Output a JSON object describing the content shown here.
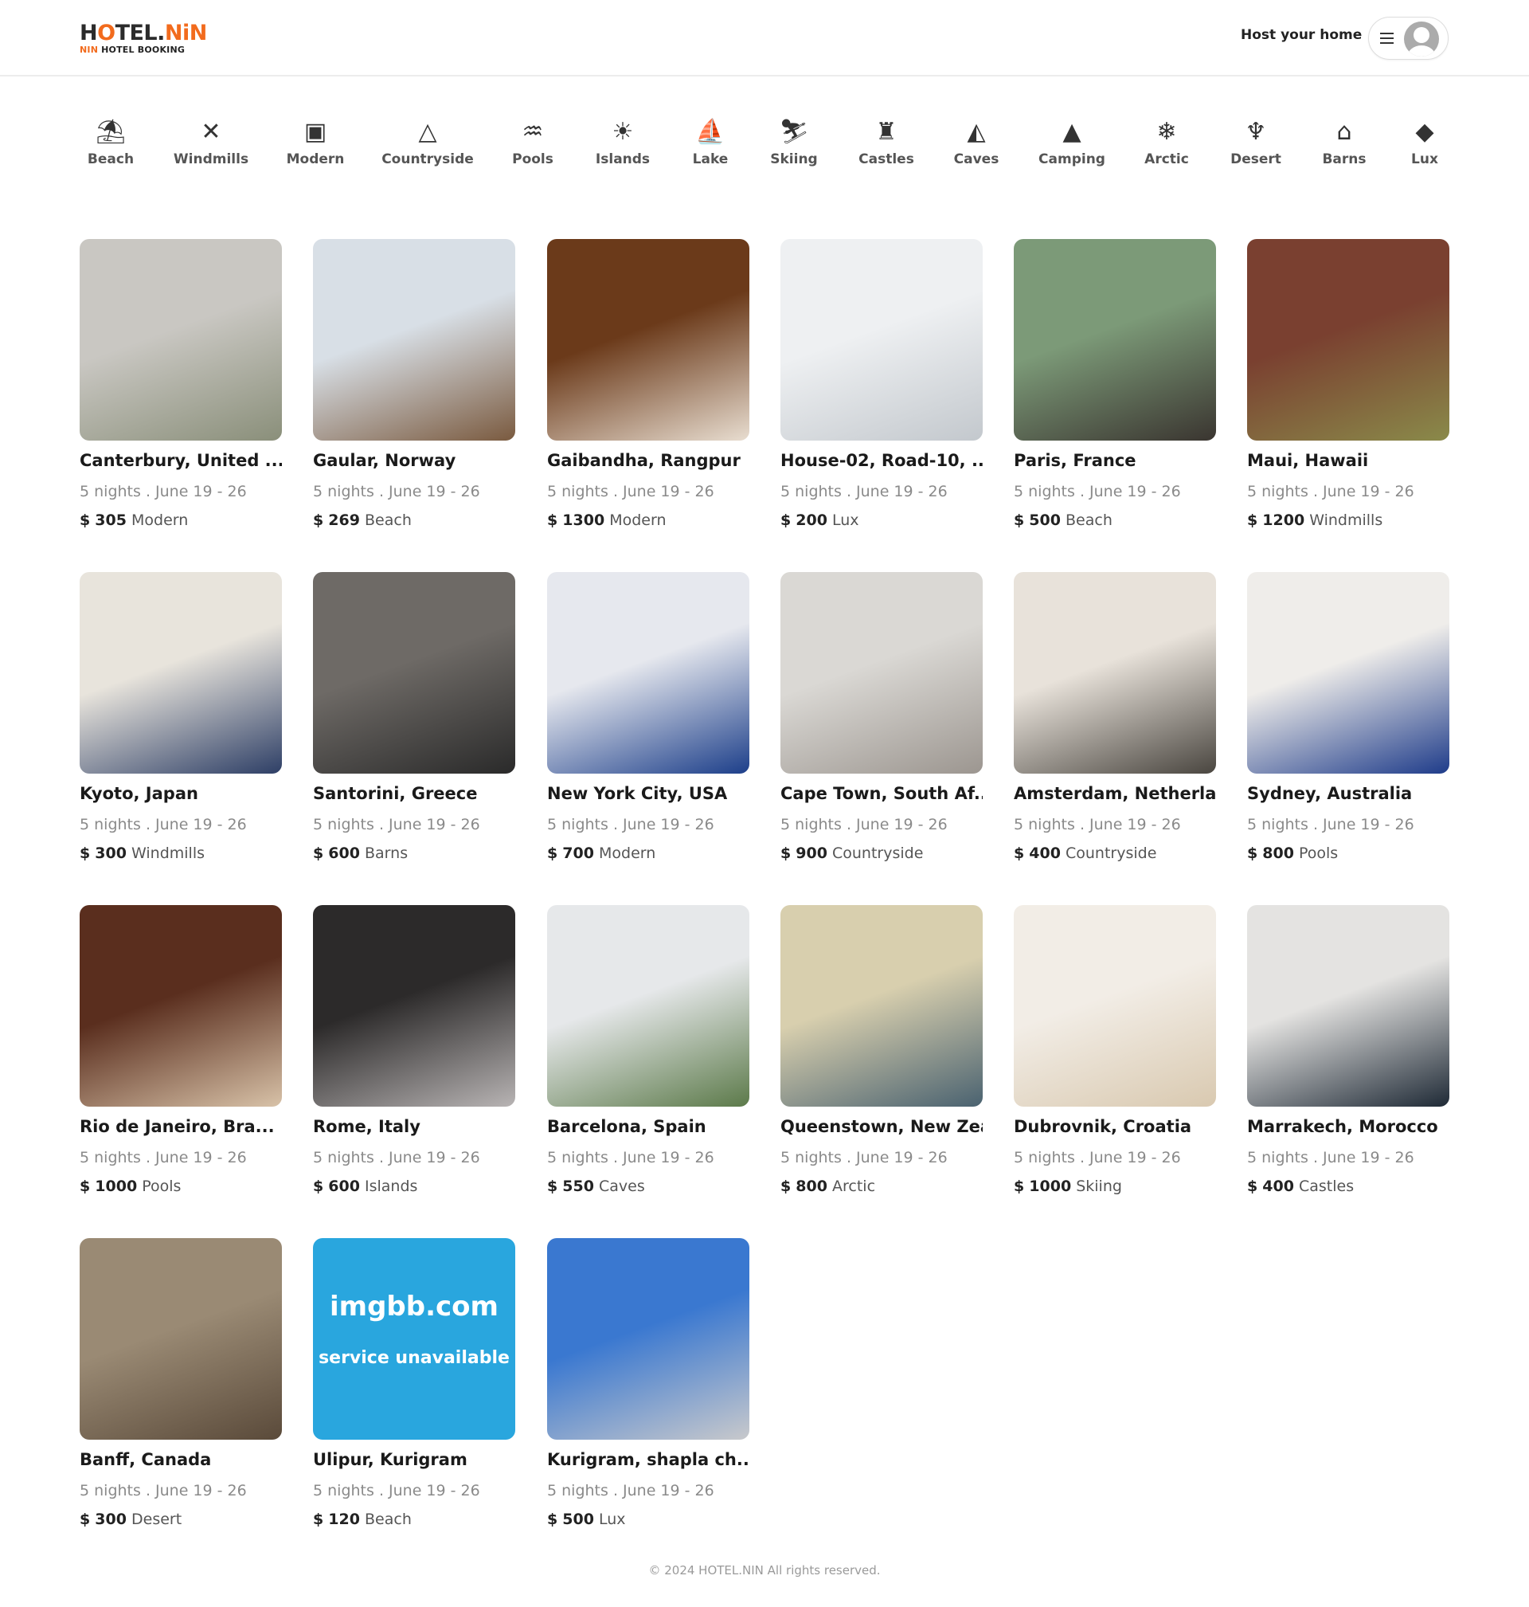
{
  "header": {
    "logo_main_1": "H",
    "logo_main_o": "O",
    "logo_main_2": "TEL.",
    "logo_main_nin": "NiN",
    "logo_sub_nin": "NIN",
    "logo_sub_rest": " HOTEL BOOKING",
    "host_label": "Host your home"
  },
  "categories": [
    {
      "label": "Beach",
      "icon": "beach-icon",
      "glyph": "⛱"
    },
    {
      "label": "Windmills",
      "icon": "windmill-icon",
      "glyph": "✕"
    },
    {
      "label": "Modern",
      "icon": "modern-building-icon",
      "glyph": "▣"
    },
    {
      "label": "Countryside",
      "icon": "mountain-icon",
      "glyph": "△"
    },
    {
      "label": "Pools",
      "icon": "pool-icon",
      "glyph": "♒"
    },
    {
      "label": "Islands",
      "icon": "island-icon",
      "glyph": "☀"
    },
    {
      "label": "Lake",
      "icon": "lake-icon",
      "glyph": "⛵"
    },
    {
      "label": "Skiing",
      "icon": "skiing-icon",
      "glyph": "⛷"
    },
    {
      "label": "Castles",
      "icon": "castle-icon",
      "glyph": "♜"
    },
    {
      "label": "Caves",
      "icon": "cave-icon",
      "glyph": "◭"
    },
    {
      "label": "Camping",
      "icon": "camping-icon",
      "glyph": "▲"
    },
    {
      "label": "Arctic",
      "icon": "snowflake-icon",
      "glyph": "❄"
    },
    {
      "label": "Desert",
      "icon": "cactus-icon",
      "glyph": "♆"
    },
    {
      "label": "Barns",
      "icon": "barn-icon",
      "glyph": "⌂"
    },
    {
      "label": "Lux",
      "icon": "diamond-icon",
      "glyph": "◆"
    }
  ],
  "listings": [
    {
      "title": "Canterbury, United ...",
      "dates": "5 nights . June 19 - 26",
      "currency": "$",
      "price": "305",
      "category": "Modern",
      "colors": [
        "#c9c7c2",
        "#8a8f7a"
      ]
    },
    {
      "title": "Gaular, Norway",
      "dates": "5 nights . June 19 - 26",
      "currency": "$",
      "price": "269",
      "category": "Beach",
      "colors": [
        "#d8dfe6",
        "#7a5a3f"
      ]
    },
    {
      "title": "Gaibandha, Rangpur",
      "dates": "5 nights . June 19 - 26",
      "currency": "$",
      "price": "1300",
      "category": "Modern",
      "colors": [
        "#6b3a1a",
        "#e8ddd0"
      ]
    },
    {
      "title": "House-02, Road-10, ...",
      "dates": "5 nights . June 19 - 26",
      "currency": "$",
      "price": "200",
      "category": "Lux",
      "colors": [
        "#eef0f2",
        "#c3c8cd"
      ]
    },
    {
      "title": "Paris, France",
      "dates": "5 nights . June 19 - 26",
      "currency": "$",
      "price": "500",
      "category": "Beach",
      "colors": [
        "#7c9a78",
        "#3a3530"
      ]
    },
    {
      "title": "Maui, Hawaii",
      "dates": "5 nights . June 19 - 26",
      "currency": "$",
      "price": "1200",
      "category": "Windmills",
      "colors": [
        "#7a4030",
        "#8a8a4a"
      ]
    },
    {
      "title": "Kyoto, Japan",
      "dates": "5 nights . June 19 - 26",
      "currency": "$",
      "price": "300",
      "category": "Windmills",
      "colors": [
        "#e8e4dc",
        "#2e3f66"
      ]
    },
    {
      "title": "Santorini, Greece",
      "dates": "5 nights . June 19 - 26",
      "currency": "$",
      "price": "600",
      "category": "Barns",
      "colors": [
        "#6e6a66",
        "#2a2a2a"
      ]
    },
    {
      "title": "New York City, USA",
      "dates": "5 nights . June 19 - 26",
      "currency": "$",
      "price": "700",
      "category": "Modern",
      "colors": [
        "#e6e8ee",
        "#1d3f8a"
      ]
    },
    {
      "title": "Cape Town, South Af...",
      "dates": "5 nights . June 19 - 26",
      "currency": "$",
      "price": "900",
      "category": "Countryside",
      "colors": [
        "#dad8d4",
        "#9c9690"
      ]
    },
    {
      "title": "Amsterdam, Netherla...",
      "dates": "5 nights . June 19 - 26",
      "currency": "$",
      "price": "400",
      "category": "Countryside",
      "colors": [
        "#e8e2da",
        "#4a4640"
      ]
    },
    {
      "title": "Sydney, Australia",
      "dates": "5 nights . June 19 - 26",
      "currency": "$",
      "price": "800",
      "category": "Pools",
      "colors": [
        "#efedea",
        "#1f3c8a"
      ]
    },
    {
      "title": "Rio de Janeiro, Bra...",
      "dates": "5 nights . June 19 - 26",
      "currency": "$",
      "price": "1000",
      "category": "Pools",
      "colors": [
        "#5a2e1e",
        "#d8c2a8"
      ]
    },
    {
      "title": "Rome, Italy",
      "dates": "5 nights . June 19 - 26",
      "currency": "$",
      "price": "600",
      "category": "Islands",
      "colors": [
        "#2c2a2a",
        "#b8b4b4"
      ]
    },
    {
      "title": "Barcelona, Spain",
      "dates": "5 nights . June 19 - 26",
      "currency": "$",
      "price": "550",
      "category": "Caves",
      "colors": [
        "#e6e8ea",
        "#5c7a4a"
      ]
    },
    {
      "title": "Queenstown, New Zea...",
      "dates": "5 nights . June 19 - 26",
      "currency": "$",
      "price": "800",
      "category": "Arctic",
      "colors": [
        "#d8cfae",
        "#4a6270"
      ]
    },
    {
      "title": "Dubrovnik, Croatia",
      "dates": "5 nights . June 19 - 26",
      "currency": "$",
      "price": "1000",
      "category": "Skiing",
      "colors": [
        "#f2ede6",
        "#d9c9b0"
      ]
    },
    {
      "title": "Marrakech, Morocco",
      "dates": "5 nights . June 19 - 26",
      "currency": "$",
      "price": "400",
      "category": "Castles",
      "colors": [
        "#e4e3e1",
        "#1f2a36"
      ]
    },
    {
      "title": "Banff, Canada",
      "dates": "5 nights . June 19 - 26",
      "currency": "$",
      "price": "300",
      "category": "Desert",
      "colors": [
        "#9a8a74",
        "#5a4a3a"
      ]
    },
    {
      "title": "Ulipur, Kurigram",
      "dates": "5 nights . June 19 - 26",
      "currency": "$",
      "price": "120",
      "category": "Beach",
      "colors": [
        "#29a6de",
        "#29a6de"
      ],
      "placeholder_line1": "imgbb.com",
      "placeholder_line2": "service unavailable"
    },
    {
      "title": "Kurigram, shapla ch...",
      "dates": "5 nights . June 19 - 26",
      "currency": "$",
      "price": "500",
      "category": "Lux",
      "colors": [
        "#3a78d0",
        "#c8c9cc"
      ]
    }
  ],
  "footer": {
    "text": "© 2024 HOTEL.NIN All rights reserved."
  }
}
